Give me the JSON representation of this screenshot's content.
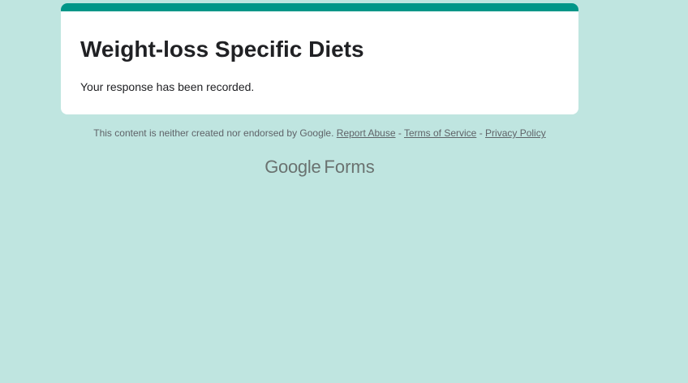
{
  "colors": {
    "page_background": "#bfe5e0",
    "accent": "#009688",
    "card_background": "#ffffff",
    "title_text": "#202124",
    "muted_text": "#5f6368"
  },
  "form": {
    "title": "Weight-loss Specific Diets",
    "confirmation_message": "Your response has been recorded."
  },
  "footer": {
    "disclaimer": "This content is neither created nor endorsed by Google.",
    "links": {
      "report_abuse": "Report Abuse",
      "terms_of_service": "Terms of Service",
      "privacy_policy": "Privacy Policy"
    },
    "separator": "-"
  },
  "branding": {
    "google": "Google",
    "forms": "Forms"
  }
}
